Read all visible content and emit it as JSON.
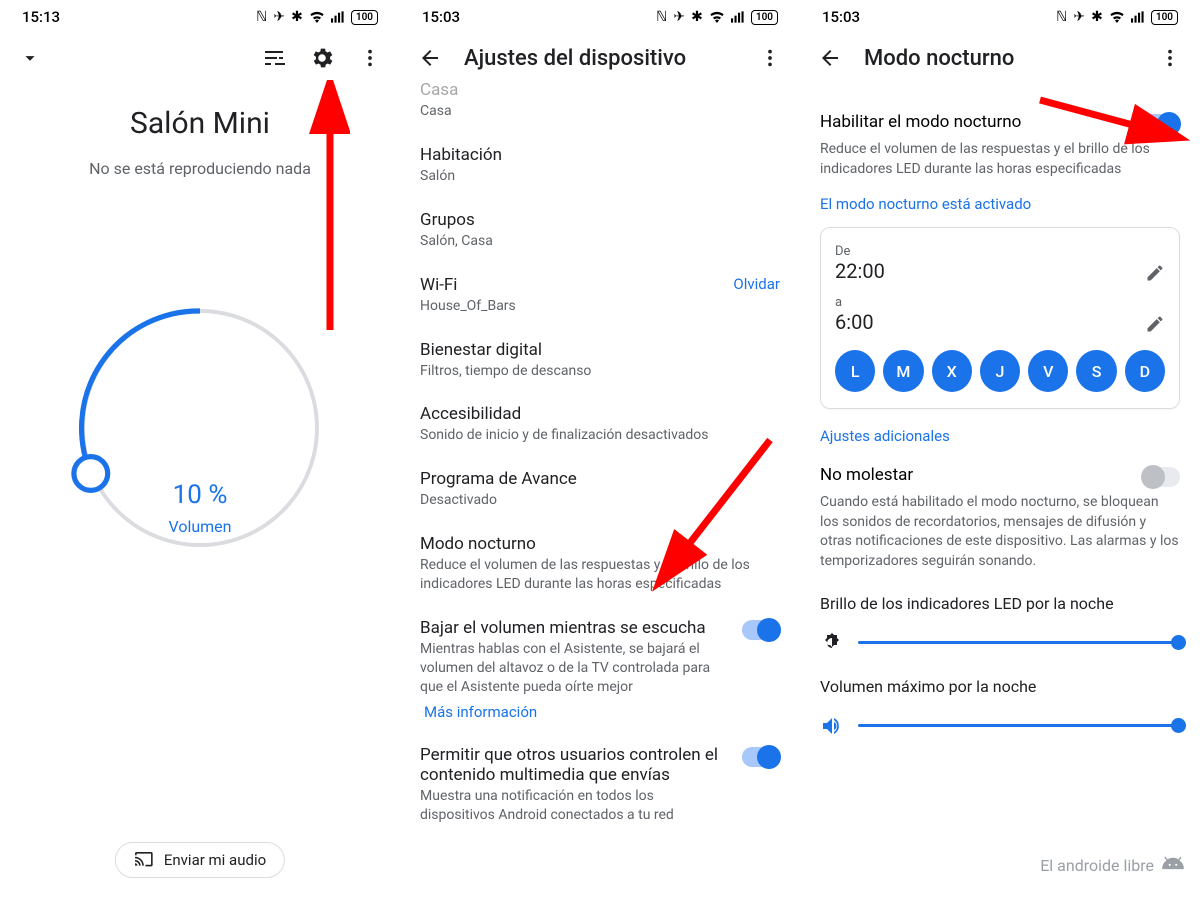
{
  "status": {
    "time1": "15:13",
    "time2": "15:03",
    "time3": "15:03",
    "battery": "100"
  },
  "panel1": {
    "title": "Salón Mini",
    "subtitle": "No se está reproduciendo nada",
    "volume_percent": "10 %",
    "volume_label": "Volumen",
    "cast_label": "Enviar mi audio"
  },
  "panel2": {
    "title": "Ajustes del dispositivo",
    "casa_label_cut": "Casa",
    "casa_sub": "Casa",
    "room_label": "Habitación",
    "room_sub": "Salón",
    "groups_label": "Grupos",
    "groups_sub": "Salón, Casa",
    "wifi_label": "Wi-Fi",
    "wifi_sub": "House_Of_Bars",
    "wifi_action": "Olvidar",
    "wellbeing_label": "Bienestar digital",
    "wellbeing_sub": "Filtros, tiempo de descanso",
    "a11y_label": "Accesibilidad",
    "a11y_sub": "Sonido de inicio y de finalización desactivados",
    "preview_label": "Programa de Avance",
    "preview_sub": "Desactivado",
    "night_label": "Modo nocturno",
    "night_sub": "Reduce el volumen de las respuestas y el brillo de los indicadores LED durante las horas especificadas",
    "lower_label": "Bajar el volumen mientras se escucha",
    "lower_sub": "Mientras hablas con el Asistente, se bajará el volumen del altavoz o de la TV controlada para que el Asistente pueda oírte mejor",
    "more_info": "Más información",
    "allow_label": "Permitir que otros usuarios controlen el contenido multimedia que envías",
    "allow_sub": "Muestra una notificación en todos los dispositivos Android conectados a tu red"
  },
  "panel3": {
    "title": "Modo nocturno",
    "enable_label": "Habilitar el modo nocturno",
    "enable_desc": "Reduce el volumen de las respuestas y el brillo de los indicadores LED durante las horas especificadas",
    "status_link": "El modo nocturno está activado",
    "from_label": "De",
    "from_time": "22:00",
    "to_label": "a",
    "to_time": "6:00",
    "days": [
      "L",
      "M",
      "X",
      "J",
      "V",
      "S",
      "D"
    ],
    "extra_link": "Ajustes adicionales",
    "dnd_label": "No molestar",
    "dnd_desc": "Cuando está habilitado el modo nocturno, se bloquean los sonidos de recordatorios, mensajes de difusión y otras notificaciones de este dispositivo. Las alarmas y los temporizadores seguirán sonando.",
    "led_label": "Brillo de los indicadores LED por la noche",
    "vol_label": "Volumen máximo por la noche"
  },
  "watermark": "El androide libre"
}
